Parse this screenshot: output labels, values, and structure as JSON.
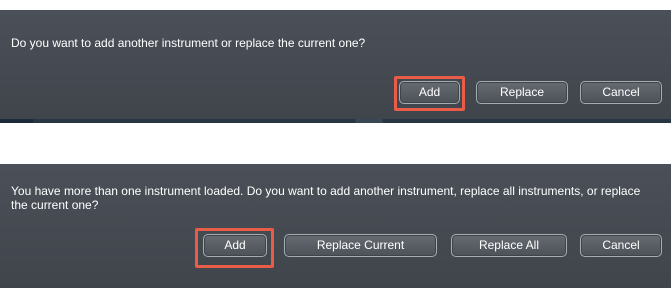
{
  "dialog_add_replace": {
    "message": "Do you want to add another instrument or replace the current one?",
    "buttons": {
      "add": "Add",
      "replace": "Replace",
      "cancel": "Cancel"
    }
  },
  "dialog_multiple_instruments": {
    "message": "You have more than one instrument loaded. Do you want to add another instrument, replace all instruments, or replace the current one?",
    "buttons": {
      "add": "Add",
      "replace_current": "Replace Current",
      "replace_all": "Replace All",
      "cancel": "Cancel"
    }
  },
  "colors": {
    "dialog_background": "#45494f",
    "highlight": "#e95d48",
    "button_border": "#a7acb3"
  }
}
